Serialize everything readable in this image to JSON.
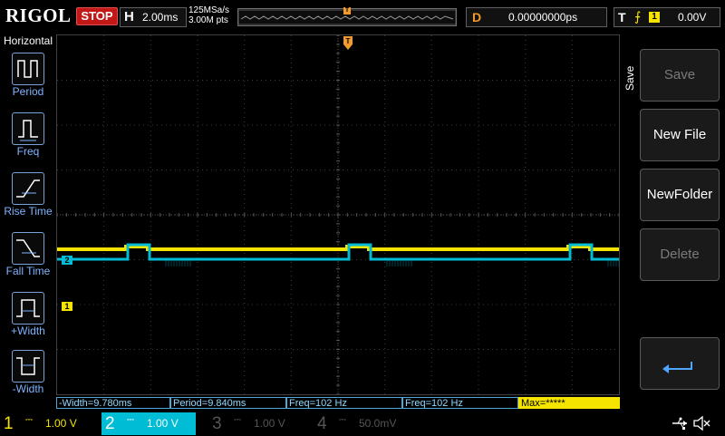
{
  "brand": "RIGOL",
  "status": "STOP",
  "horizontal": {
    "label": "H",
    "timebase": "2.00ms",
    "sample_rate": "125MSa/s",
    "points": "3.00M pts"
  },
  "delay": {
    "label": "D",
    "value": "0.00000000ps"
  },
  "trigger": {
    "label": "T",
    "source": "1",
    "level": "0.00V",
    "edge_icon": "rising-edge-icon",
    "marker": "T"
  },
  "left_menu": {
    "title": "Horizontal",
    "items": [
      {
        "label": "Period",
        "icon": "period-icon"
      },
      {
        "label": "Freq",
        "icon": "freq-icon"
      },
      {
        "label": "Rise Time",
        "icon": "rise-time-icon"
      },
      {
        "label": "Fall Time",
        "icon": "fall-time-icon"
      },
      {
        "label": "+Width",
        "icon": "pos-width-icon"
      },
      {
        "label": "-Width",
        "icon": "neg-width-icon"
      }
    ]
  },
  "right_menu": {
    "title": "Save",
    "buttons": [
      {
        "label": "Save",
        "enabled": false
      },
      {
        "label": "New File",
        "enabled": true
      },
      {
        "label": "NewFolder",
        "enabled": true
      },
      {
        "label": "Delete",
        "enabled": false
      },
      {
        "label": "",
        "icon": "enter-arrow-icon",
        "enabled": true
      }
    ]
  },
  "channel_markers": {
    "ch1": "1",
    "ch2": "2"
  },
  "measurements": [
    {
      "text": "-Width=9.780ms"
    },
    {
      "text": "Period=9.840ms"
    },
    {
      "text": "Freq=102 Hz"
    },
    {
      "text": "Freq=102 Hz"
    },
    {
      "text": "Max=*****"
    }
  ],
  "channels": [
    {
      "num": "1",
      "scale": "1.00 V",
      "color": "#f5e400",
      "active": true
    },
    {
      "num": "2",
      "scale": "1.00 V",
      "color": "#00bcd4",
      "active": true
    },
    {
      "num": "3",
      "scale": "1.00 V",
      "color": "#555555",
      "active": false
    },
    {
      "num": "4",
      "scale": "50.0mV",
      "color": "#555555",
      "active": false
    }
  ],
  "colors": {
    "ch1": "#f5e400",
    "ch2": "#00bcd4",
    "trigger": "#f39a2a",
    "stop": "#c21818"
  },
  "status_icons": [
    "usb-icon",
    "speaker-muted-icon"
  ]
}
